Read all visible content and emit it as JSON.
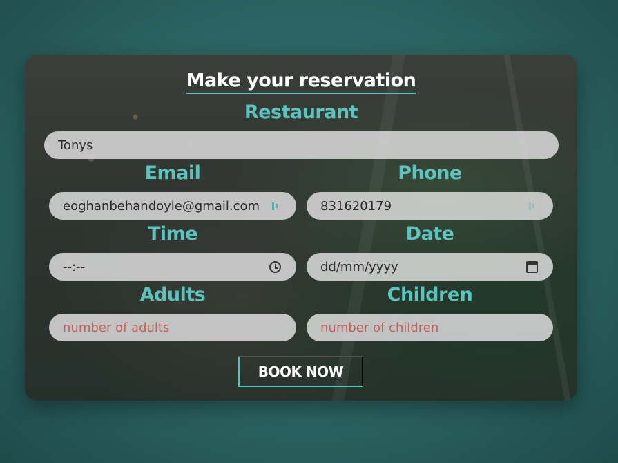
{
  "form": {
    "title": "Make your reservation",
    "restaurant_label": "Restaurant",
    "restaurant_value": "Tonys",
    "email_label": "Email",
    "email_value": "eoghanbehandoyle@gmail.com",
    "phone_label": "Phone",
    "phone_value": "831620179",
    "time_label": "Time",
    "time_value": "--:--",
    "date_label": "Date",
    "date_value": "dd/mm/yyyy",
    "adults_label": "Adults",
    "adults_placeholder": "number of adults",
    "children_label": "Children",
    "children_placeholder": "number of children",
    "submit_label": "BOOK NOW"
  },
  "icons": {
    "email_field": "password-manager-icon",
    "phone_field": "password-manager-icon",
    "time_field": "clock-icon",
    "date_field": "calendar-icon"
  },
  "colors": {
    "accent": "#4ec7c0",
    "label": "#5ec2bd",
    "placeholder": "#c0635f",
    "background": "#2b6362"
  }
}
